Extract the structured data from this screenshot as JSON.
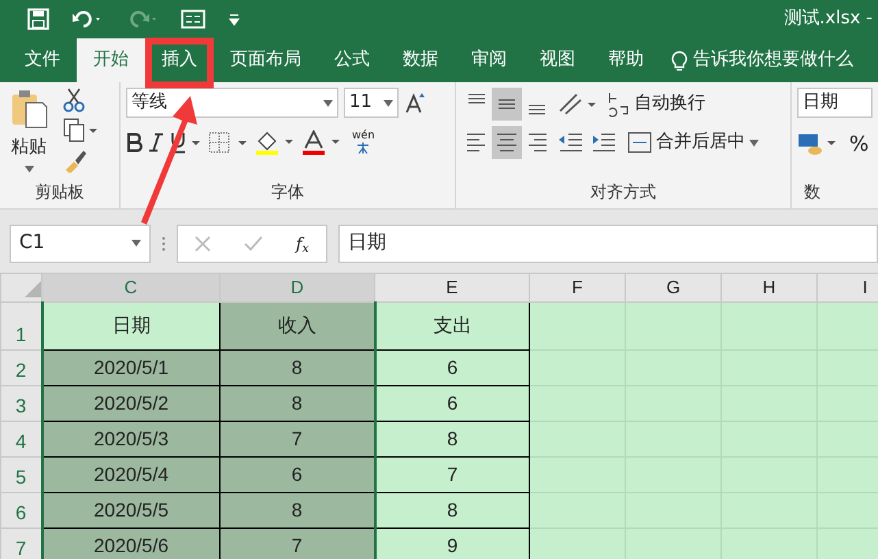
{
  "title_bar": {
    "title": "测试.xlsx -"
  },
  "tabs": [
    {
      "label": "文件",
      "selected": false
    },
    {
      "label": "开始",
      "selected": true
    },
    {
      "label": "插入",
      "selected": false
    },
    {
      "label": "页面布局",
      "selected": false
    },
    {
      "label": "公式",
      "selected": false
    },
    {
      "label": "数据",
      "selected": false
    },
    {
      "label": "审阅",
      "selected": false
    },
    {
      "label": "视图",
      "selected": false
    },
    {
      "label": "帮助",
      "selected": false
    }
  ],
  "tell_me": "告诉我你想要做什么",
  "ribbon": {
    "paste_label": "粘贴",
    "font_name": "等线",
    "font_size": "11",
    "wen_label": "wén",
    "wrap_text": "自动换行",
    "merge_center": "合并后居中",
    "number_format": "日期",
    "percent": "%",
    "vertical_align": [
      {
        "kind": "top",
        "selected": false
      },
      {
        "kind": "middle",
        "selected": true
      },
      {
        "kind": "bottom",
        "selected": false
      }
    ],
    "horizontal_align": [
      {
        "kind": "left",
        "selected": false
      },
      {
        "kind": "center",
        "selected": true
      },
      {
        "kind": "right",
        "selected": false
      }
    ],
    "groups": [
      {
        "label": "剪贴板"
      },
      {
        "label": "字体"
      },
      {
        "label": "对齐方式"
      },
      {
        "label": "数"
      }
    ]
  },
  "formula_bar": {
    "name_box": "C1",
    "function_label": "f$_{x}$",
    "content": "日期"
  },
  "columns": [
    {
      "label": "C",
      "selected": true
    },
    {
      "label": "D",
      "selected": true
    },
    {
      "label": "E",
      "selected": false
    },
    {
      "label": "F",
      "selected": false
    },
    {
      "label": "G",
      "selected": false
    },
    {
      "label": "H",
      "selected": false
    },
    {
      "label": "I",
      "selected": false
    }
  ],
  "rows": [
    {
      "number": "1",
      "selected": true,
      "cells": [
        {
          "text": "日期",
          "selected": false
        },
        {
          "text": "收入",
          "selected": true
        },
        {
          "text": "支出",
          "selected": false
        }
      ]
    },
    {
      "number": "2",
      "selected": true,
      "cells": [
        {
          "text": "2020/5/1",
          "selected": true
        },
        {
          "text": "8",
          "selected": true
        },
        {
          "text": "6",
          "selected": false
        }
      ]
    },
    {
      "number": "3",
      "selected": true,
      "cells": [
        {
          "text": "2020/5/2",
          "selected": true
        },
        {
          "text": "8",
          "selected": true
        },
        {
          "text": "6",
          "selected": false
        }
      ]
    },
    {
      "number": "4",
      "selected": true,
      "cells": [
        {
          "text": "2020/5/3",
          "selected": true
        },
        {
          "text": "7",
          "selected": true
        },
        {
          "text": "8",
          "selected": false
        }
      ]
    },
    {
      "number": "5",
      "selected": true,
      "cells": [
        {
          "text": "2020/5/4",
          "selected": true
        },
        {
          "text": "6",
          "selected": true
        },
        {
          "text": "7",
          "selected": false
        }
      ]
    },
    {
      "number": "6",
      "selected": true,
      "cells": [
        {
          "text": "2020/5/5",
          "selected": true
        },
        {
          "text": "8",
          "selected": true
        },
        {
          "text": "8",
          "selected": false
        }
      ]
    },
    {
      "number": "7",
      "selected": true,
      "cells": [
        {
          "text": "2020/5/6",
          "selected": true
        },
        {
          "text": "7",
          "selected": true
        },
        {
          "text": "9",
          "selected": false
        }
      ]
    }
  ]
}
